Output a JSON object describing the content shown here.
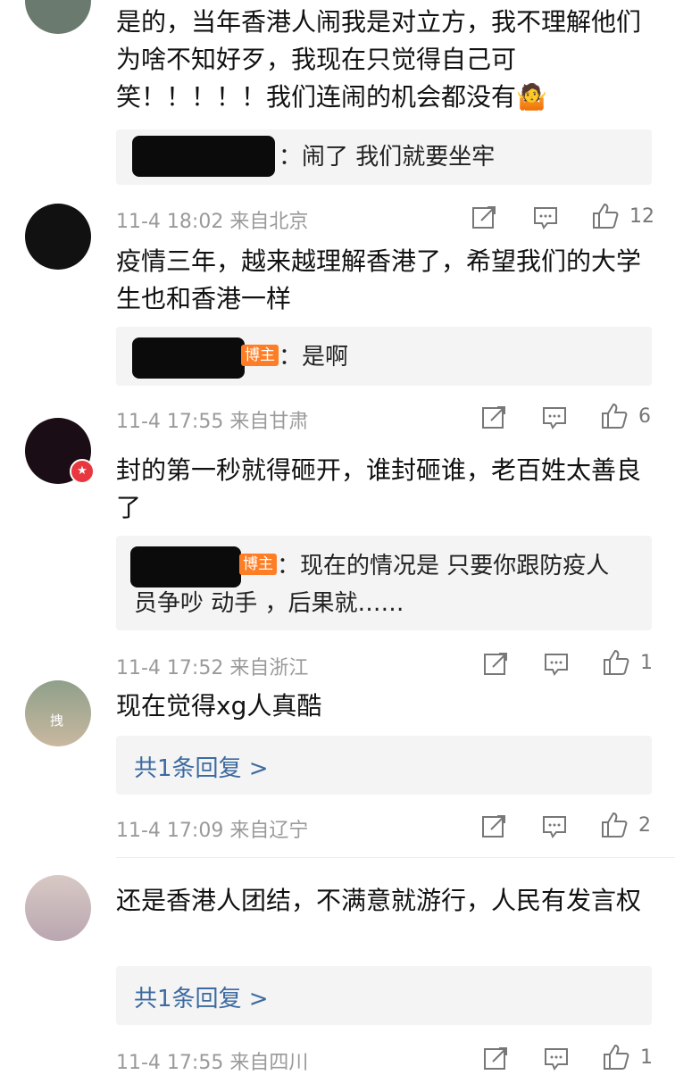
{
  "comments": [
    {
      "text": "是的，当年香港人闹我是对立方，我不理解他们为啥不知好歹，我现在只觉得自己可笑！！！！！我们连闹的机会都没有🤷",
      "reply": {
        "text": "：闹了 我们就要坐牢"
      },
      "time": "11-4 18:02 来自北京",
      "likes": "12"
    },
    {
      "text": "疫情三年，越来越理解香港了，希望我们的大学生也和香港一样",
      "reply": {
        "badge": "博主",
        "text": "：是啊"
      },
      "time": "11-4 17:55 来自甘肃",
      "likes": "6"
    },
    {
      "text": "封的第一秒就得砸开，谁封砸谁，老百姓太善良了",
      "reply": {
        "badge": "博主",
        "line1": "：现在的情况是 只要你跟防疫人",
        "line2": "员争吵 动手 ，后果就……"
      },
      "time": "11-4 17:52 来自浙江",
      "likes": "1"
    },
    {
      "text": "现在觉得xg人真酷",
      "avatar_char": "拽",
      "reply": {
        "more": "共1条回复 >"
      },
      "time": "11-4 17:09 来自辽宁",
      "likes": "2"
    },
    {
      "text": "还是香港人团结，不满意就游行，人民有发言权",
      "reply": {
        "more": "共1条回复 >"
      },
      "time": "11-4 17:55 来自四川",
      "likes": "1"
    }
  ],
  "colors": {
    "link": "#3c6aa0",
    "badge": "#ff7d24",
    "meta": "#9a9a9a"
  }
}
